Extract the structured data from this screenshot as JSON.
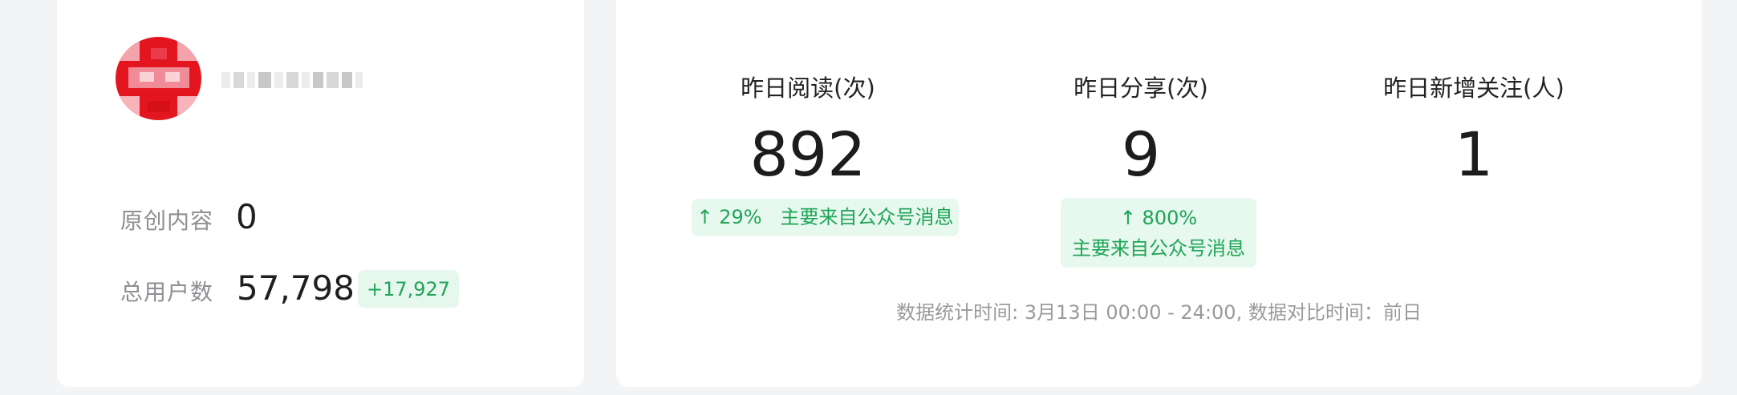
{
  "account": {
    "avatar_icon": "account-avatar-icon",
    "name": ""
  },
  "account_stats": {
    "original_label": "原创内容",
    "original_value": "0",
    "users_label": "总用户数",
    "users_value": "57,798",
    "users_delta": "+17,927"
  },
  "metrics": [
    {
      "title": "昨日阅读(次)",
      "value": "892",
      "delta": "↑ 29%",
      "source": "主要来自公众号消息"
    },
    {
      "title": "昨日分享(次)",
      "value": "9",
      "delta": "↑ 800%",
      "source": "主要来自公众号消息"
    },
    {
      "title": "昨日新增关注(人)",
      "value": "1"
    }
  ],
  "footnote": "数据统计时间: 3月13日 00:00 - 24:00, 数据对比时间：前日",
  "colors": {
    "positive": "#1fa457",
    "positive_bg": "#e6f7ed",
    "avatar": "#e3151f"
  }
}
